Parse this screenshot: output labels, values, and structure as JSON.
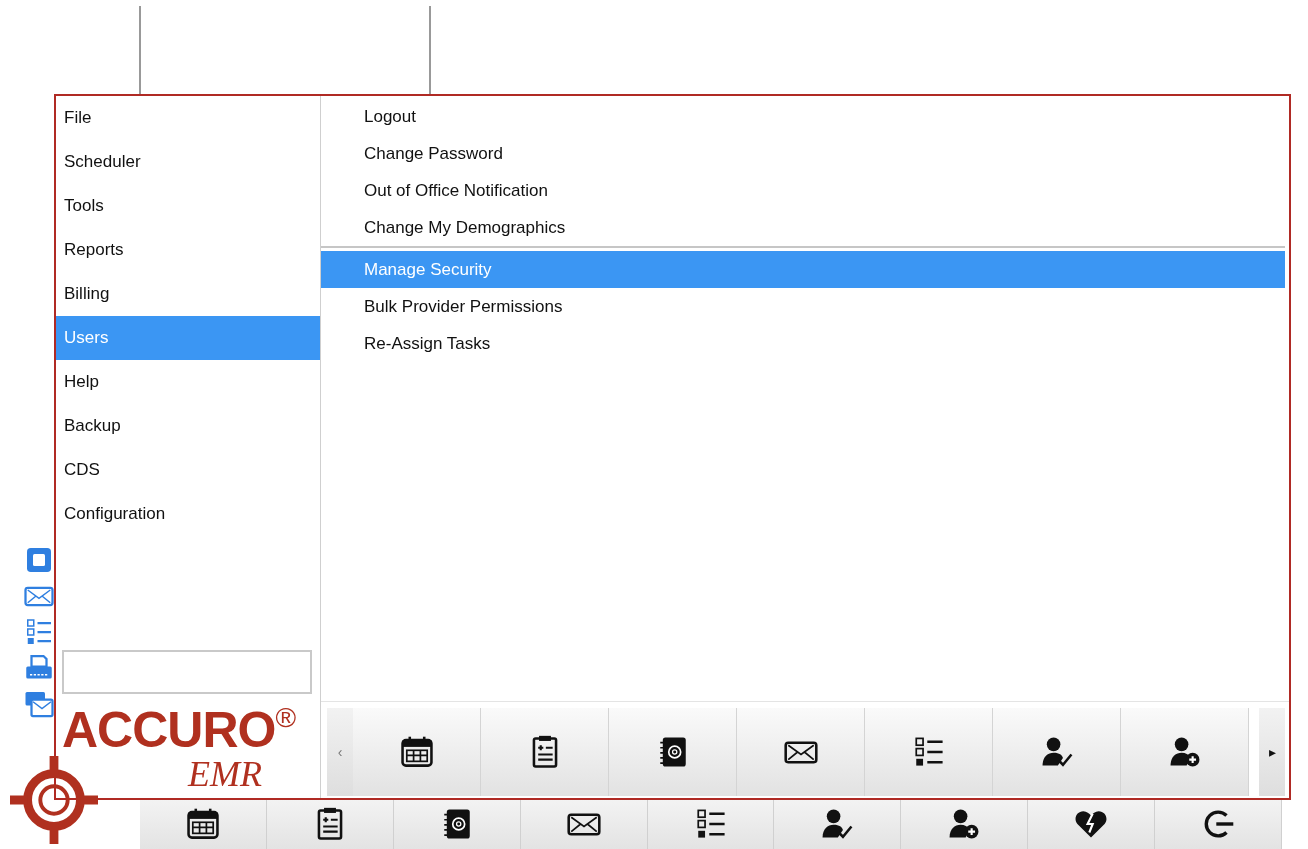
{
  "background": {
    "side_icons": [
      {
        "kind": "square"
      },
      {
        "kind": "envelope"
      },
      {
        "kind": "checklist"
      },
      {
        "kind": "printer"
      },
      {
        "kind": "messages"
      }
    ],
    "toolbar": [
      {
        "kind": "calendar"
      },
      {
        "kind": "clipboard"
      },
      {
        "kind": "address-book"
      },
      {
        "kind": "envelope"
      },
      {
        "kind": "checklist"
      },
      {
        "kind": "user-check"
      },
      {
        "kind": "user-add"
      },
      {
        "kind": "heart-bolt"
      },
      {
        "kind": "logout"
      }
    ]
  },
  "menu": {
    "categories": [
      {
        "label": "File",
        "selected": false
      },
      {
        "label": "Scheduler",
        "selected": false
      },
      {
        "label": "Tools",
        "selected": false
      },
      {
        "label": "Reports",
        "selected": false
      },
      {
        "label": "Billing",
        "selected": false
      },
      {
        "label": "Users",
        "selected": true
      },
      {
        "label": "Help",
        "selected": false
      },
      {
        "label": "Backup",
        "selected": false
      },
      {
        "label": "CDS",
        "selected": false
      },
      {
        "label": "Configuration",
        "selected": false
      }
    ],
    "submenu_groups": [
      [
        {
          "label": "Logout",
          "selected": false
        },
        {
          "label": "Change Password",
          "selected": false
        },
        {
          "label": "Out of Office Notification",
          "selected": false
        },
        {
          "label": "Change My Demographics",
          "selected": false
        }
      ],
      [
        {
          "label": "Manage Security",
          "selected": true
        },
        {
          "label": "Bulk Provider Permissions",
          "selected": false
        },
        {
          "label": "Re-Assign Tasks",
          "selected": false
        }
      ]
    ],
    "logo": {
      "brand": "ACCURO",
      "mark": "®",
      "product": "EMR"
    },
    "toolbar": {
      "scroll_left": "‹",
      "scroll_right": "▸",
      "buttons": [
        {
          "kind": "calendar"
        },
        {
          "kind": "clipboard"
        },
        {
          "kind": "address-book"
        },
        {
          "kind": "envelope"
        },
        {
          "kind": "checklist"
        },
        {
          "kind": "user-check"
        },
        {
          "kind": "user-add"
        }
      ]
    }
  }
}
